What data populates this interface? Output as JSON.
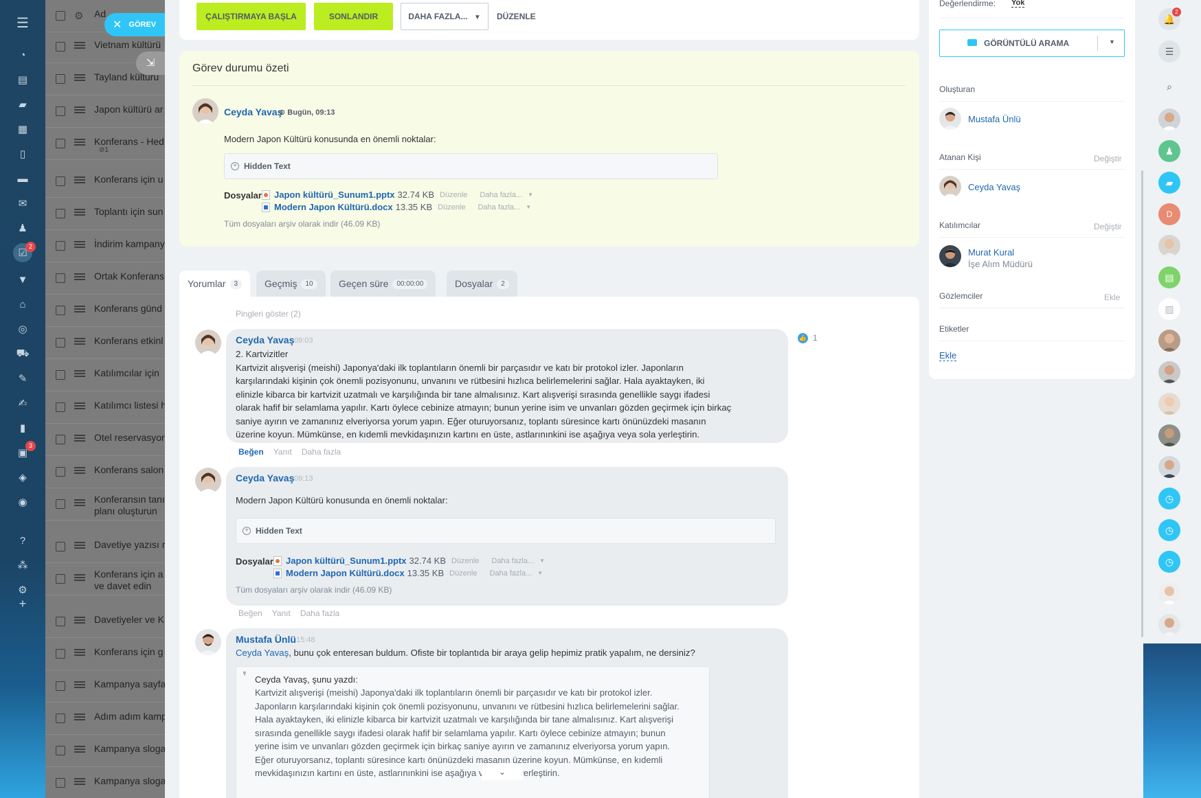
{
  "task_list": {
    "header": "Ad",
    "rows": [
      {
        "title": "Vietnam kültürü"
      },
      {
        "title": "Tayland kültürü"
      },
      {
        "title": "Japon kültürü ar"
      },
      {
        "title": "Konferans - Hed",
        "sub": "1"
      },
      {
        "title": "Konferans için u"
      },
      {
        "title": "Toplantı için sun"
      },
      {
        "title": "İndirim kampany"
      },
      {
        "title": "Ortak Konferans"
      },
      {
        "title": "Konferans günd"
      },
      {
        "title": "Konferans etkinl"
      },
      {
        "title": "Katılımcılar için"
      },
      {
        "title": "Katılımcı listesi h"
      },
      {
        "title": "Otel reservasyon"
      },
      {
        "title": "Konferans salon"
      },
      {
        "title": "Konferansın tanı",
        "title2": "planı oluşturun"
      },
      {
        "title": "Davetiye yazısı r"
      },
      {
        "title": "Konferans için a",
        "title2": "ve davet edin"
      },
      {
        "title": "Davetiyeler ve K"
      },
      {
        "title": "Konferans için g"
      },
      {
        "title": "Kampanya sayfa"
      },
      {
        "title": "Adım adım kamp"
      },
      {
        "title": "Kampanya sloga"
      },
      {
        "title": "Kampanya sloga"
      }
    ]
  },
  "rail": {
    "badge_tasks": "2",
    "badge_crm": "3"
  },
  "close_tab": {
    "label": "GÖREV"
  },
  "toolbar": {
    "start": "ÇALIŞTIRMAYA BAŞLA",
    "finish": "SONLANDIR",
    "more": "DAHA FAZLA...",
    "edit": "DÜZENLE"
  },
  "summary": {
    "title": "Görev durumu özeti",
    "author": "Ceyda Yavaş",
    "time": "Bugün, 09:13",
    "text": "Modern Japon Kültürü konusunda en önemli noktalar:",
    "hidden": "Hidden Text",
    "files_label": "Dosyalar:",
    "files": [
      {
        "name": "Japon kültürü_Sunum1.pptx",
        "size": "32.74 KB",
        "edit": "Düzenle",
        "more": "Daha fazla..."
      },
      {
        "name": "Modern Japon Kültürü.docx",
        "size": "13.35 KB",
        "edit": "Düzenle",
        "more": "Daha fazla..."
      }
    ],
    "archive": "Tüm dosyaları arşiv olarak indir (46.09 KB)"
  },
  "tabs": [
    {
      "label": "Yorumlar",
      "count": "3"
    },
    {
      "label": "Geçmiş",
      "count": "10"
    },
    {
      "label": "Geçen süre",
      "count": "00:00:00"
    },
    {
      "label": "Dosyalar",
      "count": "2"
    }
  ],
  "comments": {
    "pings": "Pingleri göster (2)",
    "c1": {
      "author": "Ceyda Yavaş",
      "time": "09:03",
      "likes": "1",
      "lines": [
        "2. Kartvizitler",
        "Kartvizit alışverişi (meishi) Japonya'daki ilk toplantıların önemli bir parçasıdır ve katı bir protokol izler. Japonların",
        "karşılarındaki kişinin çok önemli pozisyonunu, unvanını ve rütbesini hızlıca belirlemelerini sağlar. Hala ayaktayken, iki",
        "elinizle kibarca bir kartvizit uzatmalı ve karşılığında bir tane almalısınız. Kart alışverişi sırasında genellikle saygı ifadesi",
        "olarak hafif bir selamlama yapılır. Kartı öylece cebinize atmayın; bunun yerine isim ve unvanları gözden geçirmek için birkaç",
        "saniye ayırın ve zamanınız elveriyorsa yorum yapın. Eğer oturuyorsanız, toplantı süresince kartı önünüzdeki masanın",
        "üzerine koyun. Mümkünse, en kıdemli mevkidaşınızın kartını en üste, astlarınınkini ise aşağıya veya sola yerleştirin."
      ],
      "like": "Beğen",
      "reply": "Yanıt",
      "more": "Daha fazla"
    },
    "c2": {
      "author": "Ceyda Yavaş",
      "time": "09:13",
      "text": "Modern Japon Kültürü konusunda en önemli noktalar:",
      "hidden": "Hidden Text",
      "files_label": "Dosyalar:",
      "files": [
        {
          "name": "Japon kültürü_Sunum1.pptx",
          "size": "32.74 KB",
          "edit": "Düzenle",
          "more": "Daha fazla..."
        },
        {
          "name": "Modern Japon Kültürü.docx",
          "size": "13.35 KB",
          "edit": "Düzenle",
          "more": "Daha fazla..."
        }
      ],
      "archive": "Tüm dosyaları arşiv olarak indir (46.09 KB)",
      "like": "Beğen",
      "reply": "Yanıt",
      "more": "Daha fazla"
    },
    "c3": {
      "author": "Mustafa Ünlü",
      "time": "15:48",
      "mention": "Ceyda Yavaş",
      "text": ", bunu çok enteresan buldum. Ofiste bir toplantıda bir araya gelip hepimiz pratik yapalım, ne dersiniz?",
      "quote_header": "Ceyda Yavaş, şunu yazdı:",
      "quote_lines": [
        "Kartvizit alışverişi (meishi) Japonya'daki ilk toplantıların önemli bir parçasıdır ve katı bir protokol izler.",
        "Japonların karşılarındaki kişinin çok önemli pozisyonunu, unvanını ve rütbesini hızlıca belirlemelerini sağlar.",
        "Hala ayaktayken, iki elinizle kibarca bir kartvizit uzatmalı ve karşılığında bir tane almalısınız. Kart alışverişi",
        "sırasında genellikle saygı ifadesi olarak hafif bir selamlama yapılır. Kartı öylece cebinize atmayın; bunun",
        "yerine isim ve unvanları gözden geçirmek için birkaç saniye ayırın ve zamanınız elveriyorsa yorum yapın.",
        "Eğer oturuyorsanız, toplantı süresince kartı önünüzdeki masanın üzerine koyun. Mümkünse, en kıdemli",
        "mevkidaşınızın kartını en üste, astlarınınkini ise aşağıya veya sola yerleştirin."
      ]
    }
  },
  "sidebar": {
    "evaluation_label": "Değerlendirme:",
    "evaluation_value": "Yok",
    "video_call": "GÖRÜNTÜLÜ ARAMA",
    "creator_label": "Oluşturan",
    "creator": "Mustafa Ünlü",
    "assignee_label": "Atanan Kişi",
    "assignee_change": "Değiştir",
    "assignee": "Ceyda Yavaş",
    "participants_label": "Katılımcılar",
    "participants_change": "Değiştir",
    "participant": "Murat Kural",
    "participant_role": "İşe Alım Müdürü",
    "observers_label": "Gözlemciler",
    "observers_add": "Ekle",
    "tags_label": "Etiketler",
    "tags_add": "Ekle"
  },
  "right_strip": {
    "notif_badge": "2",
    "avatar_letter": "D"
  },
  "colors": {
    "accent": "#2067b0",
    "green": "#bbed21",
    "cyan": "#2fc6f6"
  }
}
